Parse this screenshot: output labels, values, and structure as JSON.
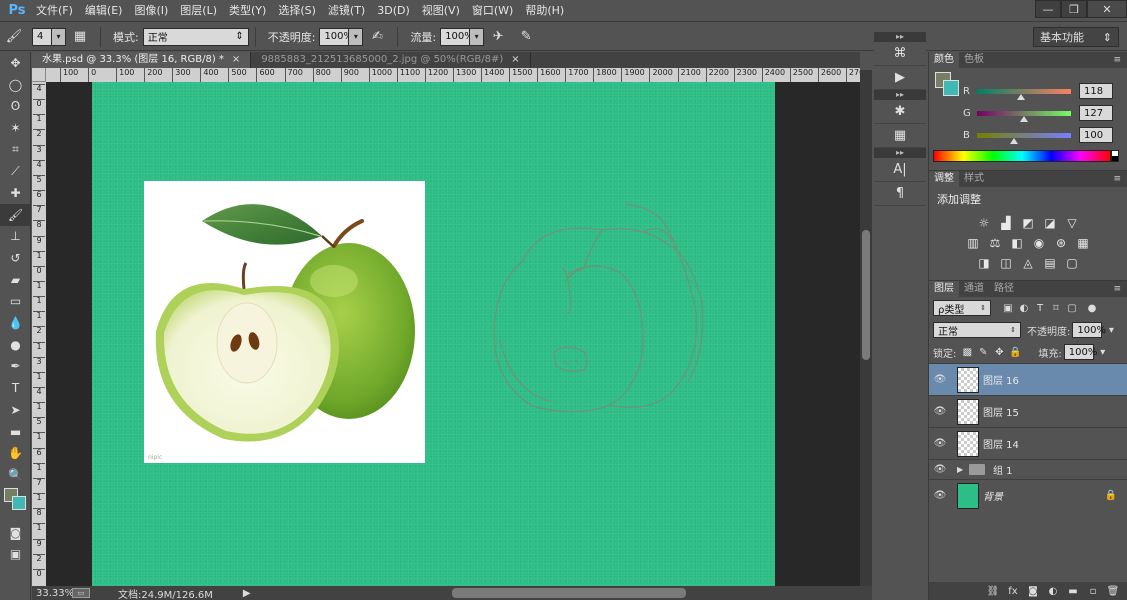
{
  "app": {
    "logo": "Ps"
  },
  "menu": [
    "文件(F)",
    "编辑(E)",
    "图像(I)",
    "图层(L)",
    "类型(Y)",
    "选择(S)",
    "滤镜(T)",
    "3D(D)",
    "视图(V)",
    "窗口(W)",
    "帮助(H)"
  ],
  "window_controls": {
    "minimize": "—",
    "restore": "❐",
    "close": "✕"
  },
  "options": {
    "brush_size": "4",
    "mode_label": "模式:",
    "mode_value": "正常",
    "opacity_label": "不透明度:",
    "opacity_value": "100%",
    "flow_label": "流量:",
    "flow_value": "100%",
    "workspace": "基本功能"
  },
  "tabs": [
    {
      "label": "水果.psd @ 33.3% (图层 16, RGB/8) *",
      "close": "×",
      "active": true
    },
    {
      "label": "9885883_212513685000_2.jpg @ 50%(RGB/8#)",
      "close": "×",
      "active": false
    }
  ],
  "ruler": {
    "h": [
      "100",
      "0",
      "100",
      "200",
      "300",
      "400",
      "500",
      "600",
      "700",
      "800",
      "900",
      "1000",
      "1100",
      "1200",
      "1300",
      "1400",
      "1500",
      "1600",
      "1700",
      "1800",
      "1900",
      "2000",
      "2100",
      "2200",
      "2300",
      "2400",
      "2500",
      "2600",
      "2700"
    ],
    "v": [
      "4",
      "0",
      "1",
      "2",
      "3",
      "4",
      "5",
      "6",
      "7",
      "8",
      "9",
      "1",
      "0",
      "1",
      "1",
      "1",
      "2",
      "1",
      "3",
      "1",
      "4",
      "1",
      "5",
      "1",
      "6",
      "1",
      "7",
      "1",
      "8",
      "1",
      "9",
      "2",
      "0"
    ]
  },
  "status": {
    "zoom": "33.33%",
    "docinfo": "文档:24.9M/126.6M"
  },
  "color_panel": {
    "tabs": [
      "颜色",
      "色板"
    ],
    "fg": "#767f64",
    "bg": "#3fb9b4",
    "channels": [
      {
        "name": "R",
        "value": "118",
        "fraction": 0.463
      },
      {
        "name": "G",
        "value": "127",
        "fraction": 0.498
      },
      {
        "name": "B",
        "value": "100",
        "fraction": 0.392
      }
    ]
  },
  "adjustments": {
    "tabs": [
      "调整",
      "样式"
    ],
    "title": "添加调整"
  },
  "layers_panel": {
    "tabs": [
      "图层",
      "通道",
      "路径"
    ],
    "filter": "ρ类型",
    "blend": "正常",
    "opacity_label": "不透明度:",
    "opacity": "100%",
    "lock_label": "锁定:",
    "fill_label": "填充:",
    "fill": "100%",
    "layers": [
      {
        "name": "图层 16",
        "selected": true,
        "kind": "layer"
      },
      {
        "name": "图层 15",
        "selected": false,
        "kind": "layer"
      },
      {
        "name": "图层 14",
        "selected": false,
        "kind": "layer"
      },
      {
        "name": "组 1",
        "selected": false,
        "kind": "group"
      },
      {
        "name": "背景",
        "selected": false,
        "kind": "background"
      }
    ]
  },
  "canvas": {
    "color": "#2dbd86"
  }
}
